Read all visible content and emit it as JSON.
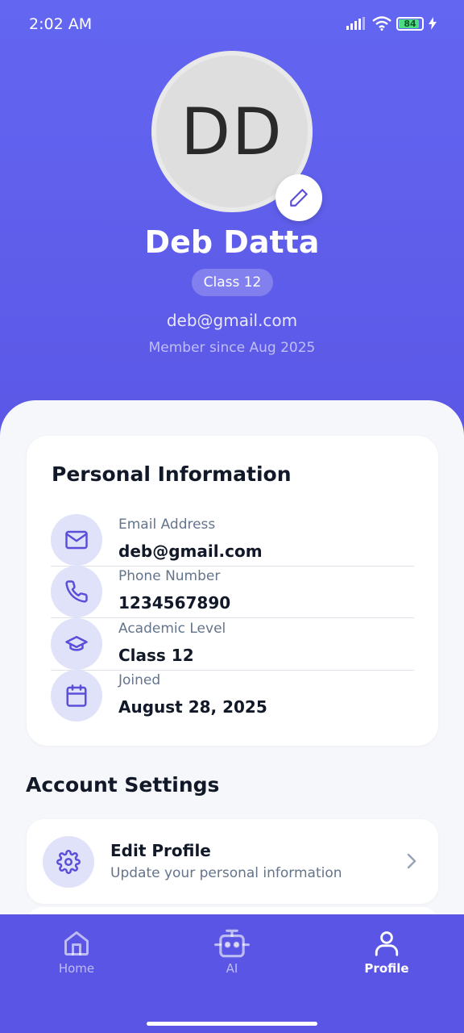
{
  "status_bar": {
    "time": "2:02 AM",
    "battery": "84",
    "battery_level": 0.84
  },
  "profile": {
    "initials": "DD",
    "name": "Deb Datta",
    "class_badge": "Class 12",
    "email": "deb@gmail.com",
    "member_since": "Member since Aug 2025"
  },
  "personal_info": {
    "title": "Personal Information",
    "rows": [
      {
        "icon": "mail-icon",
        "label": "Email Address",
        "value": "deb@gmail.com"
      },
      {
        "icon": "phone-icon",
        "label": "Phone Number",
        "value": "1234567890"
      },
      {
        "icon": "graduation-cap-icon",
        "label": "Academic Level",
        "value": "Class 12"
      },
      {
        "icon": "calendar-icon",
        "label": "Joined",
        "value": "August 28, 2025"
      }
    ]
  },
  "account_settings": {
    "title": "Account Settings",
    "items": [
      {
        "icon": "gear-icon",
        "title": "Edit Profile",
        "subtitle": "Update your personal information"
      }
    ]
  },
  "bottom_nav": {
    "items": [
      {
        "icon": "home-icon",
        "label": "Home",
        "active": false
      },
      {
        "icon": "robot-icon",
        "label": "AI",
        "active": false
      },
      {
        "icon": "user-icon",
        "label": "Profile",
        "active": true
      }
    ]
  },
  "colors": {
    "accent": "#5b57e6",
    "icon_bg": "#e0e2f9",
    "icon_fg": "#5b4fd9"
  }
}
